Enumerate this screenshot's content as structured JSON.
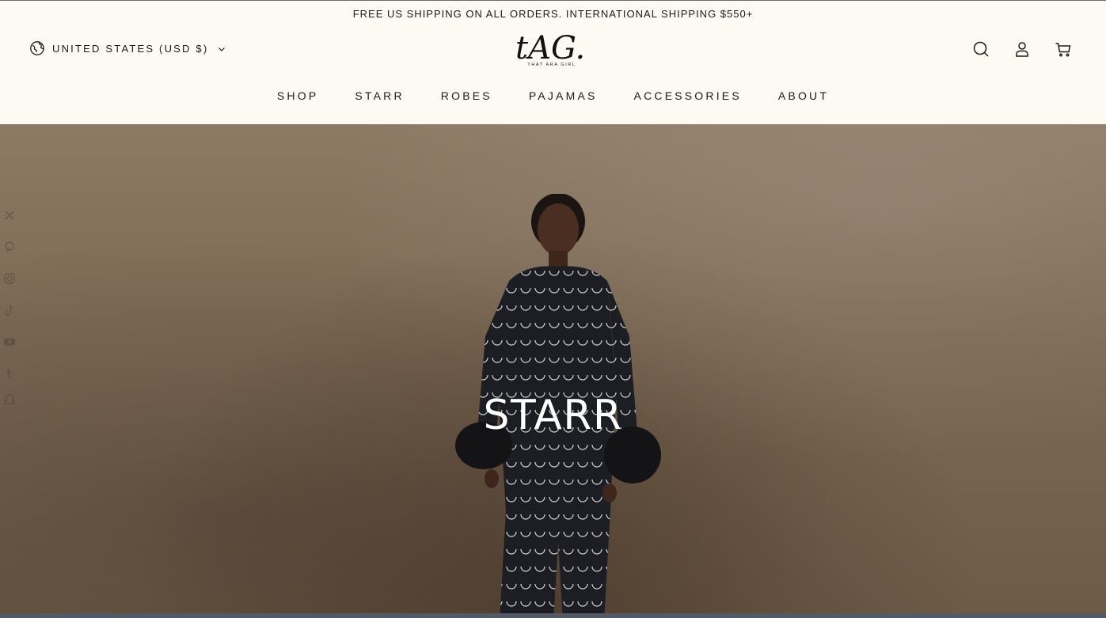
{
  "announcement": "FREE US SHIPPING ON ALL ORDERS. INTERNATIONAL SHIPPING $550+",
  "header": {
    "currency_label": "UNITED STATES (USD $)",
    "logo_text": "tAG.",
    "logo_subtext": "THAT ARA GIRL"
  },
  "nav": [
    "SHOP",
    "STARR",
    "ROBES",
    "PAJAMAS",
    "ACCESSORIES",
    "ABOUT"
  ],
  "hero": {
    "title": "STARR"
  },
  "social_icons": [
    "x-icon",
    "pinterest-icon",
    "instagram-icon",
    "tiktok-icon",
    "youtube-icon",
    "tumblr-icon",
    "snapchat-icon"
  ],
  "colors": {
    "header_bg": "#fdf9f3",
    "hero_bg": "#857260",
    "text": "#1b1b1b",
    "hero_title": "#ffffff"
  }
}
